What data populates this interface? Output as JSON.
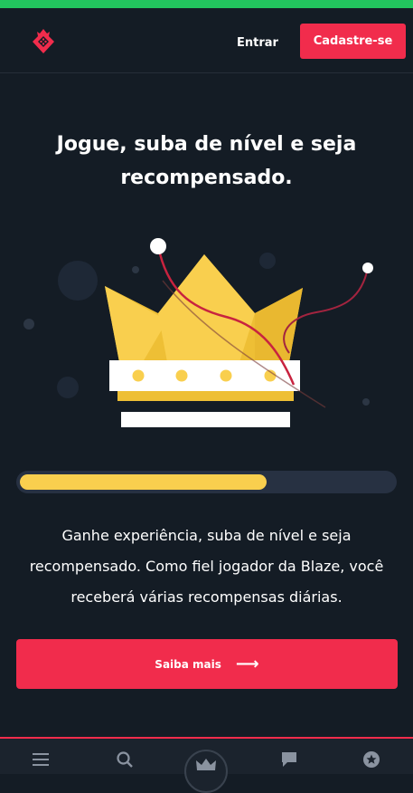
{
  "header": {
    "logo_icon": "blaze-logo-icon",
    "login_label": "Entrar",
    "signup_label": "Cadastre-se"
  },
  "hero": {
    "title": "Jogue, suba de nível e seja recompensado.",
    "illustration_icon": "crown-icon",
    "progress_fraction": 0.66,
    "description": "Ganhe experiência, suba de nível e seja recompensado. Como fiel jogador da Blaze, você receberá várias recompensas diárias.",
    "cta_label": "Saiba mais",
    "cta_icon": "arrow-right-icon"
  },
  "bottom_nav": {
    "items": [
      "menu-icon",
      "search-icon",
      "crown-icon",
      "chat-icon",
      "star-icon"
    ]
  },
  "colors": {
    "background": "#141c25",
    "accent": "#f12c4c",
    "gold": "#f9cf4e",
    "status_bar": "#22c55e",
    "progress_track": "#273142"
  }
}
